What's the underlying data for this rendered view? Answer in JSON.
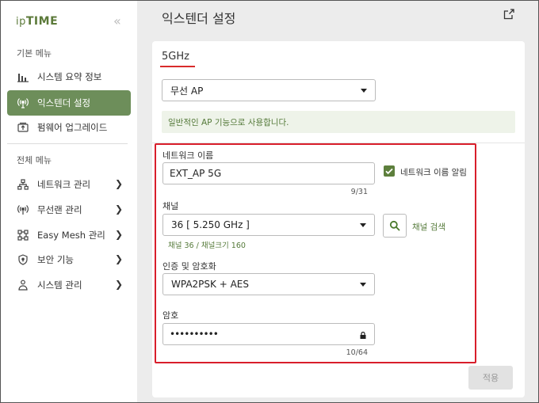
{
  "sidebar": {
    "logo": {
      "ip": "ip",
      "time": "TIME"
    },
    "collapse_icon": "double-chevron-left",
    "basic_menu_label": "기본 메뉴",
    "basic_items": [
      {
        "label": "시스템 요약 정보",
        "icon": "bar-chart-icon"
      },
      {
        "label": "익스텐더 설정",
        "icon": "wireless-antenna-icon",
        "active": true
      },
      {
        "label": "펌웨어 업그레이드",
        "icon": "upgrade-icon"
      }
    ],
    "all_menu_label": "전체 메뉴",
    "all_items": [
      {
        "label": "네트워크 관리",
        "icon": "network-icon"
      },
      {
        "label": "무선랜 관리",
        "icon": "wireless-icon"
      },
      {
        "label": "Easy Mesh 관리",
        "icon": "mesh-icon"
      },
      {
        "label": "보안 기능",
        "icon": "shield-icon"
      },
      {
        "label": "시스템 관리",
        "icon": "system-icon"
      }
    ]
  },
  "header": {
    "title": "익스텐더 설정",
    "export_icon": "export-icon"
  },
  "band": {
    "title": "5GHz"
  },
  "mode": {
    "selected": "무선 AP",
    "info": "일반적인 AP 기능으로 사용합니다."
  },
  "form": {
    "ssid": {
      "label": "네트워크 이름",
      "value": "EXT_AP 5G",
      "counter": "9/31"
    },
    "hide_ssid": {
      "label": "네트워크 이름 알림",
      "checked": true
    },
    "channel": {
      "label": "채널",
      "selected": "36 [ 5.250 GHz ]",
      "hint": "채널 36 / 채널크기 160",
      "search_label": "채널 검색"
    },
    "security": {
      "label": "인증 및 암호화",
      "selected": "WPA2PSK + AES"
    },
    "password": {
      "label": "암호",
      "value": "••••••••••",
      "counter": "10/64"
    }
  },
  "apply_label": "적용",
  "colors": {
    "accent": "#6d8e5a",
    "highlight": "#d81e2b",
    "hint": "#557a3a"
  }
}
